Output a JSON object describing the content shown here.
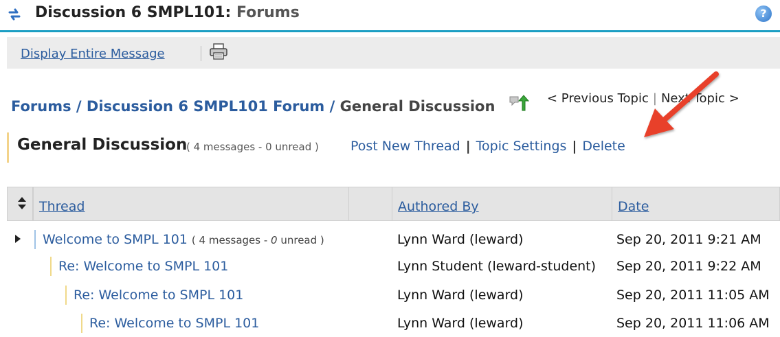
{
  "header": {
    "title_prefix": "Discussion 6 SMPL101:",
    "title_suffix": "Forums",
    "sync_icon": "sync-arrows-icon",
    "help_icon": "help-icon",
    "help_label": "?"
  },
  "toolbar": {
    "display_label": "Display Entire Message",
    "print_icon": "printer-icon"
  },
  "breadcrumb": {
    "forums": "Forums",
    "sep1": "/",
    "forum": "Discussion 6 SMPL101 Forum",
    "sep2": "/",
    "current": "General Discussion",
    "up_icon": "up-level-icon"
  },
  "topic_nav": {
    "previous": "< Previous Topic",
    "separator": "|",
    "next": "Next Topic >"
  },
  "topic": {
    "title": "General Discussion",
    "count": "( 4 messages - 0 unread )",
    "actions": {
      "post_new_thread": "Post New Thread",
      "topic_settings": "Topic Settings",
      "delete": "Delete",
      "separator": "|"
    }
  },
  "table": {
    "headers": {
      "thread": "Thread",
      "authored_by": "Authored By",
      "date": "Date"
    },
    "rows": [
      {
        "thread": "Welcome to SMPL 101",
        "count_prefix": "( 4 messages - ",
        "count_unread": "0",
        "count_suffix": " unread )",
        "author": "Lynn Ward (leward)",
        "date": "Sep 20, 2011 9:21 AM"
      },
      {
        "thread": "Re: Welcome to SMPL 101",
        "author": "Lynn Student (leward-student)",
        "date": "Sep 20, 2011 9:22 AM"
      },
      {
        "thread": "Re: Welcome to SMPL 101",
        "author": "Lynn Ward (leward)",
        "date": "Sep 20, 2011 11:05 AM"
      },
      {
        "thread": "Re: Welcome to SMPL 101",
        "author": "Lynn Ward (leward)",
        "date": "Sep 20, 2011 11:06 AM"
      }
    ]
  },
  "colors": {
    "link": "#2b5c9e",
    "title_rule": "#1b9ec3",
    "arrow": "#e8402a",
    "thread_bar": "#f0d98a"
  }
}
